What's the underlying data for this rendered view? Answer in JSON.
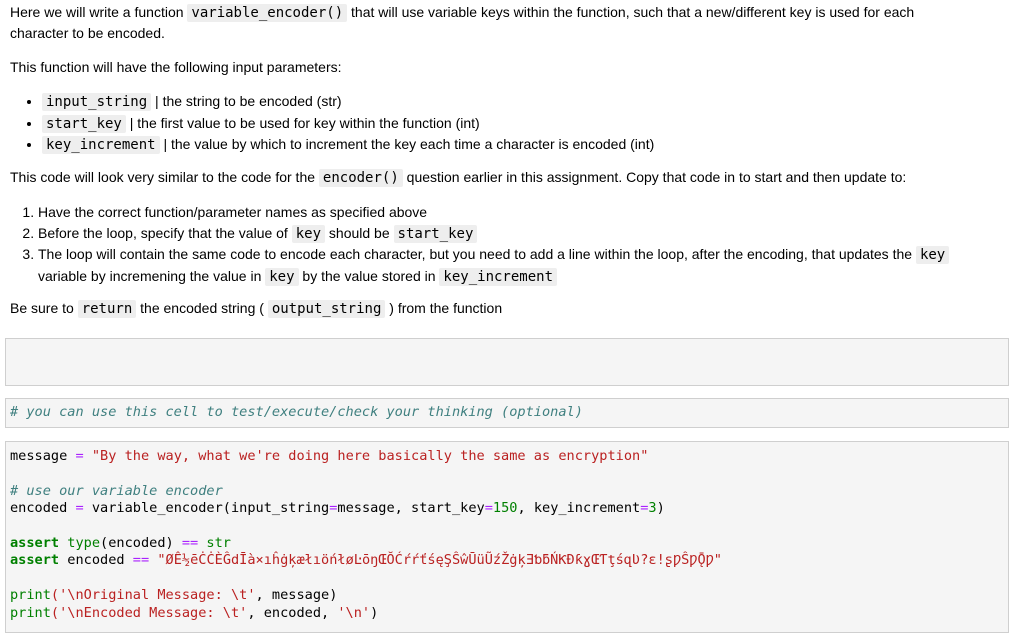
{
  "intro": {
    "p1_before": "Here we will write a function ",
    "p1_code": "variable_encoder()",
    "p1_after_a": " that will use variable keys within the function, such that a new/different key is used for each",
    "p1_after_b": "character to be encoded.",
    "p2": "This function will have the following input parameters:",
    "params": [
      {
        "code": "input_string",
        "desc": " | the string to be encoded (str)"
      },
      {
        "code": "start_key",
        "desc": " | the first value to be used for key within the function (int)"
      },
      {
        "code": "key_increment",
        "desc": " | the value by which to increment the key each time a character is encoded (int)"
      }
    ],
    "p3_before": "This code will look very similar to the code for the ",
    "p3_code": "encoder()",
    "p3_after": " question earlier in this assignment. Copy that code in to start and then update to:",
    "steps": {
      "s1": "Have the correct function/parameter names as specified above",
      "s2_before": "Before the loop, specify that the value of ",
      "s2_code1": "key",
      "s2_mid": " should be ",
      "s2_code2": "start_key",
      "s3_before": "The loop will contain the same code to encode each character, but you need to add a line within the loop, after the encoding, that updates the ",
      "s3_code1": "key",
      "s3_line2_before": "variable by incremening the value in ",
      "s3_code2": "key",
      "s3_line2_mid": " by the value stored in ",
      "s3_code3": "key_increment"
    },
    "p4_before": "Be sure to ",
    "p4_code1": "return",
    "p4_mid": " the encoded string ( ",
    "p4_code2": "output_string",
    "p4_after": " ) from the function"
  },
  "cells": {
    "test_comment": "# you can use this cell to test/execute/check your thinking (optional)",
    "code": {
      "l1_var": "message ",
      "l1_op": "=",
      "l1_str": " \"By the way, what we're doing here basically the same as encryption\"",
      "l2_comment": "# use our variable encoder",
      "l3_a": "encoded ",
      "l3_op1": "=",
      "l3_b": " variable_encoder(input_string",
      "l3_op2": "=",
      "l3_c": "message, start_key",
      "l3_op3": "=",
      "l3_n1": "150",
      "l3_d": ", key_increment",
      "l3_op4": "=",
      "l3_n2": "3",
      "l3_e": ")",
      "l4_kw": "assert",
      "l4_bi": " type",
      "l4_a": "(encoded) ",
      "l4_op": "==",
      "l4_bi2": " str",
      "l5_kw": "assert",
      "l5_a": " encoded ",
      "l5_op": "==",
      "l5_str": " \"ØÊ½ēĊĊÈĜdĪà×ıĥġķæłıöńłøĿōŋŒŎĆŕŕťśęŞŜŵŪüŨźŽġķƎƅƃŃƘƉƙɣŒƬţśզƲ?ɛ!ʂǷŜǷǬǷ\"",
      "l6_bi": "print",
      "l6_str": "('\\nOriginal Message: \\t'",
      "l6_rest": ", message)",
      "l7_bi": "print",
      "l7_str": "('\\nEncoded Message: \\t'",
      "l7_rest": ", encoded, ",
      "l7_str2": "'\\n'",
      "l7_end": ")"
    }
  }
}
